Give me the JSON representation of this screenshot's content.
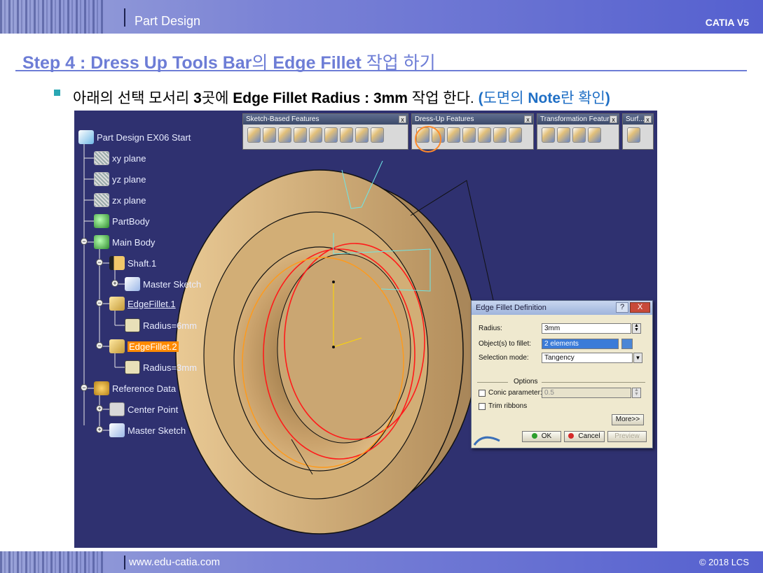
{
  "header": {
    "title": "Part Design",
    "brand": "CATIA V5"
  },
  "footer": {
    "url": "www.edu-catia.com",
    "copyright": "© 2018 LCS"
  },
  "step": {
    "title_a": "Step 4 : Dress Up Tools Bar",
    "title_b": "의 ",
    "title_c": "Edge Fillet",
    "title_d": " 작업 하기"
  },
  "instruction": {
    "p1": "아래의 선택 모서리 ",
    "p2": "3",
    "p3": "곳에 ",
    "p4": "Edge Fillet Radius : 3mm",
    "p5": " 작업 한다. ",
    "p6": "(",
    "p7": "도면의 ",
    "p8": "Note",
    "p9": "란 확인",
    "p10": ")"
  },
  "tree": {
    "root": "Part Design EX06 Start",
    "xy": "xy plane",
    "yz": "yz plane",
    "zx": "zx plane",
    "partbody": "PartBody",
    "mainbody": "Main Body",
    "shaft": "Shaft.1",
    "master_sketch_1": "Master Sketch",
    "edgefillet1": "EdgeFillet.1",
    "radius6": "Radius=6mm",
    "edgefillet2": "EdgeFillet.2",
    "radius3": "Radius=3mm",
    "refdata": "Reference Data",
    "center": "Center Point",
    "master_sketch_2": "Master Sketch"
  },
  "toolbars": {
    "sketch_based": "Sketch-Based Features",
    "dress_up": "Dress-Up Features",
    "transformation": "Transformation Features",
    "surf": "Surf...",
    "close": "x"
  },
  "dialog": {
    "title": "Edge Fillet Definition",
    "help": "?",
    "close": "X",
    "radius_label": "Radius:",
    "radius_value": "3mm",
    "objects_label": "Object(s) to fillet:",
    "objects_value": "2 elements",
    "selection_label": "Selection mode:",
    "selection_value": "Tangency",
    "options_label": "Options",
    "conic_label": "Conic parameter:",
    "conic_value": "0.5",
    "trim_label": "Trim ribbons",
    "more": "More>>",
    "ok": "OK",
    "cancel": "Cancel",
    "preview": "Preview"
  },
  "colors": {
    "accent": "#6d7dd6",
    "instruction_blue": "#1f6fc5",
    "viewport_bg": "#2f3170",
    "part": "#d9b57c",
    "highlight": "#ff8a00"
  }
}
